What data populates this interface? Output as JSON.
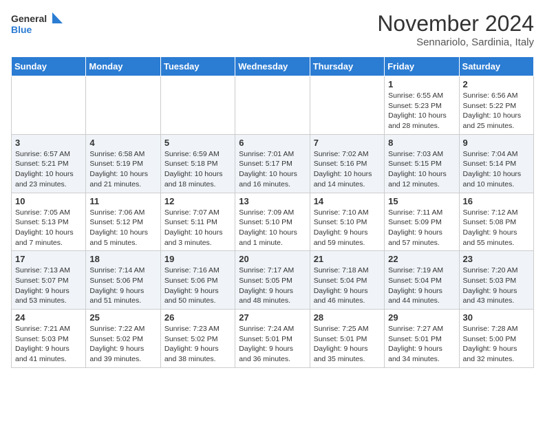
{
  "header": {
    "logo_line1": "General",
    "logo_line2": "Blue",
    "month": "November 2024",
    "location": "Sennariolo, Sardinia, Italy"
  },
  "days_of_week": [
    "Sunday",
    "Monday",
    "Tuesday",
    "Wednesday",
    "Thursday",
    "Friday",
    "Saturday"
  ],
  "weeks": [
    [
      {
        "day": "",
        "info": ""
      },
      {
        "day": "",
        "info": ""
      },
      {
        "day": "",
        "info": ""
      },
      {
        "day": "",
        "info": ""
      },
      {
        "day": "",
        "info": ""
      },
      {
        "day": "1",
        "info": "Sunrise: 6:55 AM\nSunset: 5:23 PM\nDaylight: 10 hours\nand 28 minutes."
      },
      {
        "day": "2",
        "info": "Sunrise: 6:56 AM\nSunset: 5:22 PM\nDaylight: 10 hours\nand 25 minutes."
      }
    ],
    [
      {
        "day": "3",
        "info": "Sunrise: 6:57 AM\nSunset: 5:21 PM\nDaylight: 10 hours\nand 23 minutes."
      },
      {
        "day": "4",
        "info": "Sunrise: 6:58 AM\nSunset: 5:19 PM\nDaylight: 10 hours\nand 21 minutes."
      },
      {
        "day": "5",
        "info": "Sunrise: 6:59 AM\nSunset: 5:18 PM\nDaylight: 10 hours\nand 18 minutes."
      },
      {
        "day": "6",
        "info": "Sunrise: 7:01 AM\nSunset: 5:17 PM\nDaylight: 10 hours\nand 16 minutes."
      },
      {
        "day": "7",
        "info": "Sunrise: 7:02 AM\nSunset: 5:16 PM\nDaylight: 10 hours\nand 14 minutes."
      },
      {
        "day": "8",
        "info": "Sunrise: 7:03 AM\nSunset: 5:15 PM\nDaylight: 10 hours\nand 12 minutes."
      },
      {
        "day": "9",
        "info": "Sunrise: 7:04 AM\nSunset: 5:14 PM\nDaylight: 10 hours\nand 10 minutes."
      }
    ],
    [
      {
        "day": "10",
        "info": "Sunrise: 7:05 AM\nSunset: 5:13 PM\nDaylight: 10 hours\nand 7 minutes."
      },
      {
        "day": "11",
        "info": "Sunrise: 7:06 AM\nSunset: 5:12 PM\nDaylight: 10 hours\nand 5 minutes."
      },
      {
        "day": "12",
        "info": "Sunrise: 7:07 AM\nSunset: 5:11 PM\nDaylight: 10 hours\nand 3 minutes."
      },
      {
        "day": "13",
        "info": "Sunrise: 7:09 AM\nSunset: 5:10 PM\nDaylight: 10 hours\nand 1 minute."
      },
      {
        "day": "14",
        "info": "Sunrise: 7:10 AM\nSunset: 5:10 PM\nDaylight: 9 hours\nand 59 minutes."
      },
      {
        "day": "15",
        "info": "Sunrise: 7:11 AM\nSunset: 5:09 PM\nDaylight: 9 hours\nand 57 minutes."
      },
      {
        "day": "16",
        "info": "Sunrise: 7:12 AM\nSunset: 5:08 PM\nDaylight: 9 hours\nand 55 minutes."
      }
    ],
    [
      {
        "day": "17",
        "info": "Sunrise: 7:13 AM\nSunset: 5:07 PM\nDaylight: 9 hours\nand 53 minutes."
      },
      {
        "day": "18",
        "info": "Sunrise: 7:14 AM\nSunset: 5:06 PM\nDaylight: 9 hours\nand 51 minutes."
      },
      {
        "day": "19",
        "info": "Sunrise: 7:16 AM\nSunset: 5:06 PM\nDaylight: 9 hours\nand 50 minutes."
      },
      {
        "day": "20",
        "info": "Sunrise: 7:17 AM\nSunset: 5:05 PM\nDaylight: 9 hours\nand 48 minutes."
      },
      {
        "day": "21",
        "info": "Sunrise: 7:18 AM\nSunset: 5:04 PM\nDaylight: 9 hours\nand 46 minutes."
      },
      {
        "day": "22",
        "info": "Sunrise: 7:19 AM\nSunset: 5:04 PM\nDaylight: 9 hours\nand 44 minutes."
      },
      {
        "day": "23",
        "info": "Sunrise: 7:20 AM\nSunset: 5:03 PM\nDaylight: 9 hours\nand 43 minutes."
      }
    ],
    [
      {
        "day": "24",
        "info": "Sunrise: 7:21 AM\nSunset: 5:03 PM\nDaylight: 9 hours\nand 41 minutes."
      },
      {
        "day": "25",
        "info": "Sunrise: 7:22 AM\nSunset: 5:02 PM\nDaylight: 9 hours\nand 39 minutes."
      },
      {
        "day": "26",
        "info": "Sunrise: 7:23 AM\nSunset: 5:02 PM\nDaylight: 9 hours\nand 38 minutes."
      },
      {
        "day": "27",
        "info": "Sunrise: 7:24 AM\nSunset: 5:01 PM\nDaylight: 9 hours\nand 36 minutes."
      },
      {
        "day": "28",
        "info": "Sunrise: 7:25 AM\nSunset: 5:01 PM\nDaylight: 9 hours\nand 35 minutes."
      },
      {
        "day": "29",
        "info": "Sunrise: 7:27 AM\nSunset: 5:01 PM\nDaylight: 9 hours\nand 34 minutes."
      },
      {
        "day": "30",
        "info": "Sunrise: 7:28 AM\nSunset: 5:00 PM\nDaylight: 9 hours\nand 32 minutes."
      }
    ]
  ]
}
